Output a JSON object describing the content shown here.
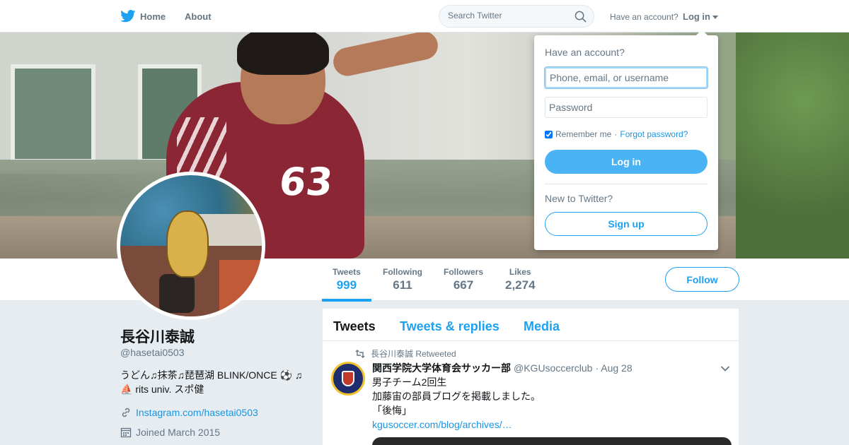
{
  "nav": {
    "home_label": "Home",
    "about_label": "About",
    "search_placeholder": "Search Twitter",
    "have_account": "Have an account?",
    "login_label": "Log in"
  },
  "profile": {
    "name": "長谷川泰誠",
    "handle": "@hasetai0503",
    "bio_line1": "うどん♫抹茶♫琵琶湖 BLINK/ONCE ⚽ ♫",
    "bio_line2": "⛵ rits univ. スポ健",
    "link": "Instagram.com/hasetai0503",
    "joined": "Joined March 2015",
    "shirt_number": "63"
  },
  "stats": [
    {
      "label": "Tweets",
      "value": "999"
    },
    {
      "label": "Following",
      "value": "611"
    },
    {
      "label": "Followers",
      "value": "667"
    },
    {
      "label": "Likes",
      "value": "2,274"
    }
  ],
  "follow_label": "Follow",
  "tabs": [
    "Tweets",
    "Tweets & replies",
    "Media"
  ],
  "tweet": {
    "retweet_line": "長谷川泰誠 Retweeted",
    "name": "関西学院大学体育会サッカー部",
    "handle": "@KGUsoccerclub",
    "date": "· Aug 28",
    "line1": "男子チーム2回生",
    "line2": "加藤宙の部員ブログを掲載しました。",
    "line3": "「後悔」",
    "url": "kgusoccer.com/blog/archives/…"
  },
  "login_dropdown": {
    "title": "Have an account?",
    "username_placeholder": "Phone, email, or username",
    "password_placeholder": "Password",
    "remember_label": "Remember me",
    "separator": "·",
    "forgot_label": "Forgot password?",
    "login_button": "Log in",
    "new_label": "New to Twitter?",
    "signup_button": "Sign up"
  },
  "colors": {
    "accent": "#1da1f2",
    "login_button": "#4ab3f4",
    "background": "#e6ecf0"
  }
}
